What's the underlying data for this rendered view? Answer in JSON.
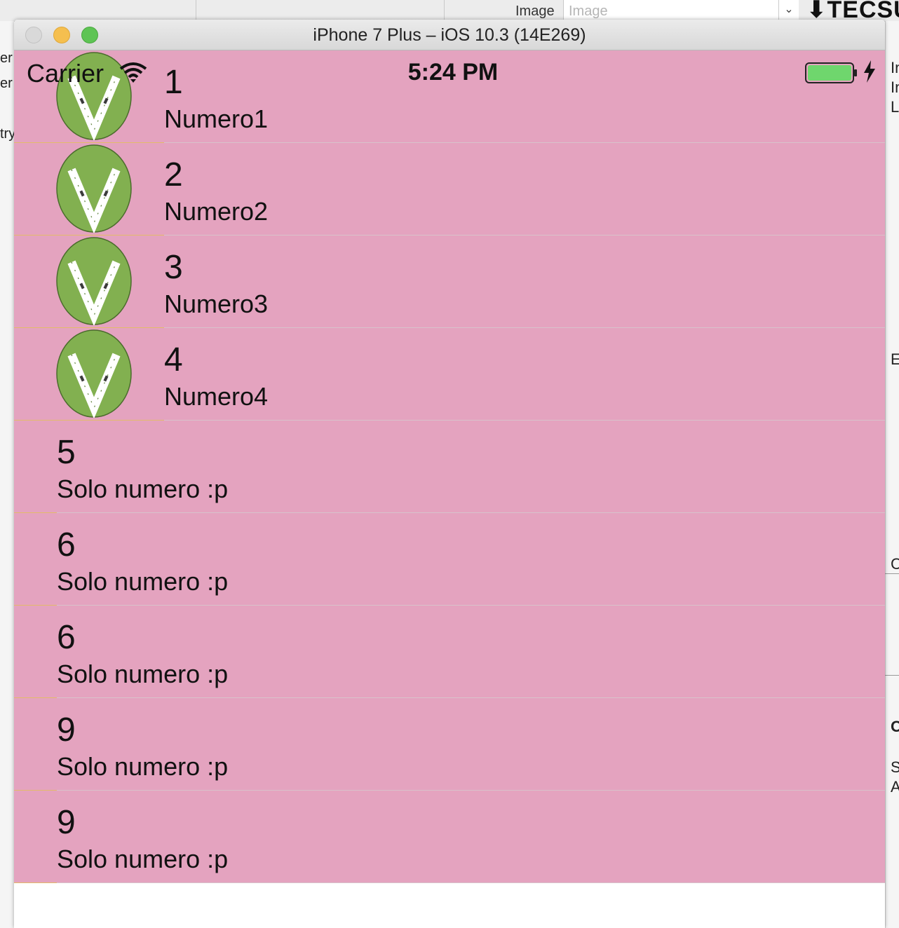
{
  "background": {
    "image_label": "Image",
    "image_placeholder": "Image",
    "logo_text": "TECSU",
    "left_fragments": [
      "er",
      "er",
      "try"
    ],
    "right_fragments": [
      "In",
      "In",
      "L",
      "E",
      "C",
      "OM",
      "S",
      "A"
    ]
  },
  "window": {
    "title": "iPhone 7 Plus – iOS 10.3 (14E269)"
  },
  "statusbar": {
    "carrier": "Carrier",
    "time": "5:24 PM",
    "battery_color": "#6fd66d"
  },
  "colors": {
    "cell_background": "#e4a3bf",
    "avatar_green": "#82b050"
  },
  "rows": [
    {
      "number": "1",
      "subtitle": "Numero1",
      "has_image": true
    },
    {
      "number": "2",
      "subtitle": "Numero2",
      "has_image": true
    },
    {
      "number": "3",
      "subtitle": "Numero3",
      "has_image": true
    },
    {
      "number": "4",
      "subtitle": "Numero4",
      "has_image": true
    },
    {
      "number": "5",
      "subtitle": "Solo numero :p",
      "has_image": false
    },
    {
      "number": "6",
      "subtitle": "Solo numero :p",
      "has_image": false
    },
    {
      "number": "6",
      "subtitle": "Solo numero :p",
      "has_image": false
    },
    {
      "number": "9",
      "subtitle": "Solo numero :p",
      "has_image": false
    },
    {
      "number": "9",
      "subtitle": "Solo numero :p",
      "has_image": false
    }
  ]
}
